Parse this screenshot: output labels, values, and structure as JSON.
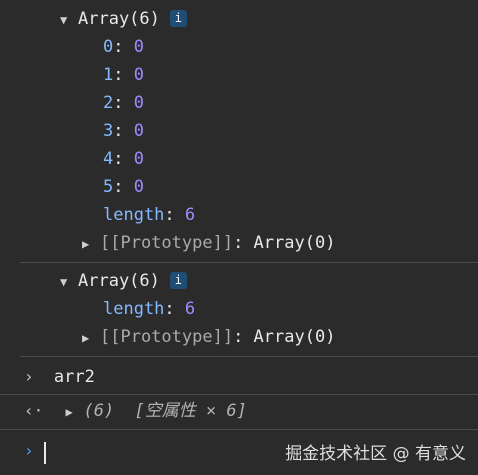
{
  "group1": {
    "header": "Array(6)",
    "badge": "i",
    "items": [
      {
        "key": "0",
        "value": "0"
      },
      {
        "key": "1",
        "value": "0"
      },
      {
        "key": "2",
        "value": "0"
      },
      {
        "key": "3",
        "value": "0"
      },
      {
        "key": "4",
        "value": "0"
      },
      {
        "key": "5",
        "value": "0"
      }
    ],
    "length_key": "length",
    "length_value": "6",
    "prototype_label": "[[Prototype]]",
    "prototype_value": "Array(0)"
  },
  "group2": {
    "header": "Array(6)",
    "badge": "i",
    "length_key": "length",
    "length_value": "6",
    "prototype_label": "[[Prototype]]",
    "prototype_value": "Array(0)"
  },
  "console": {
    "command": "arr2",
    "result_count": "(6)",
    "result_text": "[空属性 × 6]",
    "input_value": ""
  },
  "watermark": "掘金技术社区 @ 有意义"
}
